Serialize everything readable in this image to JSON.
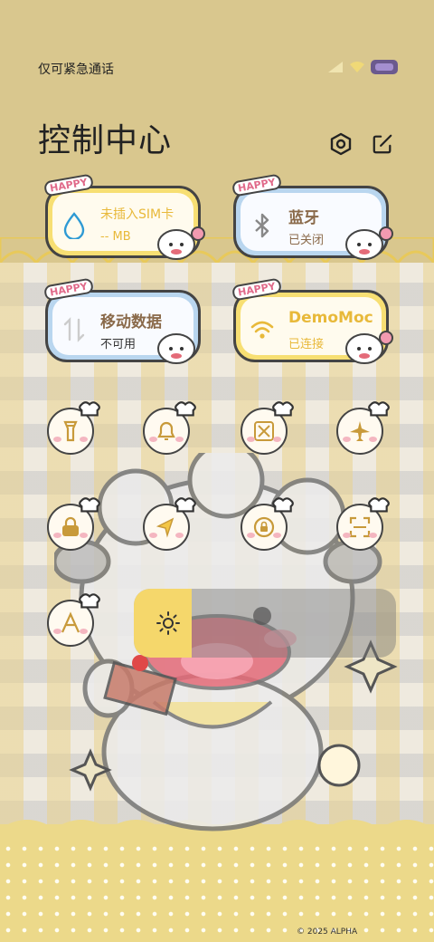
{
  "status_bar": {
    "carrier": "仅可紧急通话"
  },
  "header": {
    "title": "控制中心",
    "settings_icon": "settings-hex-icon",
    "edit_icon": "edit-icon"
  },
  "tiles": [
    {
      "id": "sim",
      "label": "未插入SIM卡",
      "sub": "-- MB",
      "icon": "water-drop-icon",
      "badge": "HAPPY",
      "style": "yellow"
    },
    {
      "id": "bluetooth",
      "label": "蓝牙",
      "sub": "已关闭",
      "icon": "bluetooth-icon",
      "badge": "HAPPY",
      "style": "blue"
    },
    {
      "id": "mobile-data",
      "label": "移动数据",
      "sub": "不可用",
      "icon": "data-arrows-icon",
      "badge": "HAPPY",
      "style": "blue"
    },
    {
      "id": "wifi",
      "label": "DemoMoc",
      "sub": "已连接",
      "icon": "wifi-icon",
      "badge": "HAPPY",
      "style": "yellow"
    }
  ],
  "toggles": [
    {
      "name": "flashlight",
      "icon": "flashlight-icon"
    },
    {
      "name": "ringer",
      "icon": "bell-icon"
    },
    {
      "name": "screenshot",
      "icon": "scissors-screenshot-icon"
    },
    {
      "name": "airplane",
      "icon": "airplane-icon"
    },
    {
      "name": "lock-screen",
      "icon": "lock-icon"
    },
    {
      "name": "location",
      "icon": "location-icon"
    },
    {
      "name": "rotation-lock",
      "icon": "rotation-lock-icon"
    },
    {
      "name": "scanner",
      "icon": "scan-icon"
    },
    {
      "name": "font-size",
      "icon": "letter-a-icon"
    }
  ],
  "brightness": {
    "level": 0.22,
    "icon": "sun-icon"
  },
  "footer": {
    "copyright": "© 2025 ALPHA"
  },
  "colors": {
    "accent_yellow": "#f5d76b",
    "accent_blue": "#b9d6ef",
    "outline": "#444444"
  }
}
